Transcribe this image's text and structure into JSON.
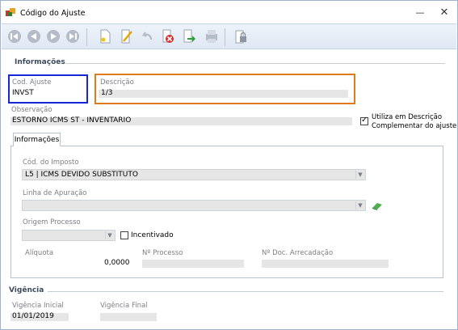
{
  "window": {
    "title": "Código do Ajuste",
    "minimize": "—",
    "close": "✕"
  },
  "toolbar": {
    "buttons": [
      {
        "icon": "first-record-icon"
      },
      {
        "icon": "previous-record-icon"
      },
      {
        "icon": "next-record-icon"
      },
      {
        "icon": "last-record-icon"
      },
      {
        "icon": "new-icon"
      },
      {
        "icon": "edit-icon"
      },
      {
        "icon": "undo-icon"
      },
      {
        "icon": "delete-icon"
      },
      {
        "icon": "save-arrow-icon"
      },
      {
        "icon": "print-icon"
      },
      {
        "icon": "lock-icon"
      }
    ]
  },
  "informacoes": {
    "section_title": "Informações",
    "cod_ajuste_label": "Cod. Ajuste",
    "cod_ajuste_value": "INVST",
    "descricao_label": "Descrição",
    "descricao_value": "1/3",
    "observacao_label": "Observação",
    "observacao_value": "ESTORNO ICMS ST - INVENTARIO",
    "utiliza_label_1": "Utiliza em Descrição",
    "utiliza_label_2": "Complementar do ajuste",
    "utiliza_checked": true
  },
  "tab": {
    "label": "Informações",
    "cod_imposto_label": "Cód. do Imposto",
    "cod_imposto_value": "L5 | ICMS DEVIDO SUBSTITUTO",
    "linha_apuracao_label": "Linha de Apuração",
    "linha_apuracao_value": "",
    "origem_processo_label": "Origem Processo",
    "origem_processo_value": "",
    "incentivado_label": "Incentivado",
    "incentivado_checked": false,
    "aliquota_label": "Alíquota",
    "aliquota_value": "0,0000",
    "num_processo_label": "Nº Processo",
    "num_processo_value": "",
    "num_doc_label": "Nº Doc. Arrecadação",
    "num_doc_value": ""
  },
  "vigencia": {
    "section_title": "Vigência",
    "inicial_label": "Vigência Inicial",
    "inicial_value": "01/01/2019",
    "final_label": "Vigência Final",
    "final_value": ""
  },
  "colors": {
    "highlight_blue": "#1528d6",
    "highlight_orange": "#e07a1a"
  }
}
